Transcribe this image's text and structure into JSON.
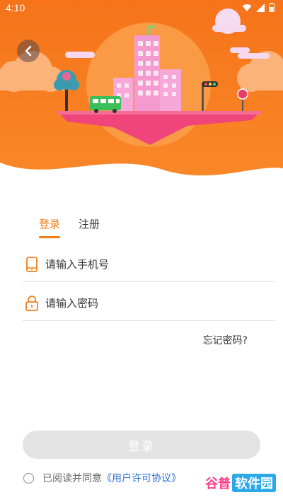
{
  "status_bar": {
    "time": "4:10"
  },
  "header": {
    "back_icon": "chevron-left-icon"
  },
  "tabs": [
    {
      "label": "登录",
      "active": true
    },
    {
      "label": "注册",
      "active": false
    }
  ],
  "form": {
    "phone": {
      "placeholder": "请输入手机号",
      "value": "",
      "icon": "phone-icon"
    },
    "password": {
      "placeholder": "请输入密码",
      "value": "",
      "icon": "lock-icon"
    },
    "forgot_label": "忘记密码?",
    "submit_label": "登录"
  },
  "agreement": {
    "prefix": "已阅读并同意",
    "link": "《用户许可协议》"
  },
  "watermark": {
    "part_a": "谷普",
    "part_b": "软件园"
  },
  "colors": {
    "accent": "#f47d14",
    "hero_orange": "#f7761b",
    "link": "#2a6fd6",
    "button_disabled": "#e3e3e3"
  }
}
